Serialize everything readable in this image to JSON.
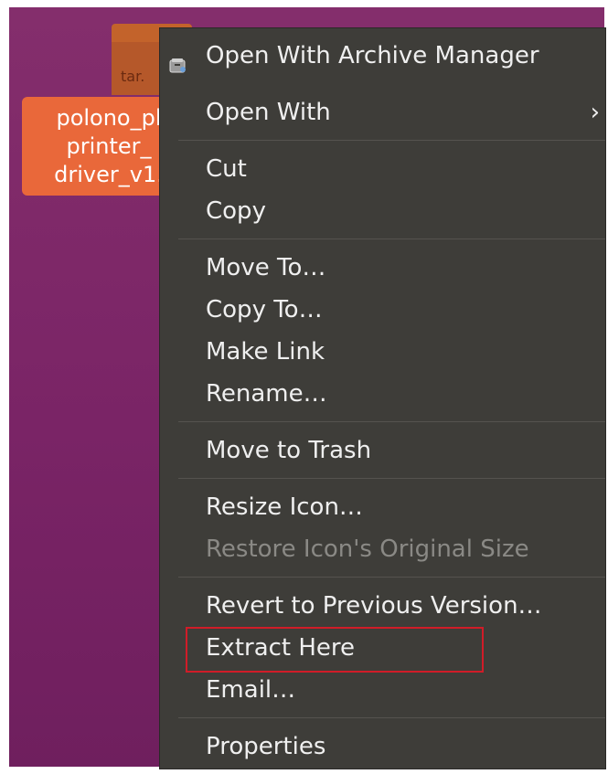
{
  "desktop": {
    "file": {
      "icon_label": "tar.",
      "name_lines": [
        "polono_pl",
        "printer_",
        "driver_v1."
      ]
    }
  },
  "context_menu": {
    "items": [
      {
        "label": "Open With Archive Manager",
        "icon": "archive-manager-icon"
      },
      {
        "label": "Open With",
        "submenu_indicator": "›"
      },
      {
        "label": "Cut"
      },
      {
        "label": "Copy"
      },
      {
        "label": "Move To…"
      },
      {
        "label": "Copy To…"
      },
      {
        "label": "Make Link"
      },
      {
        "label": "Rename…"
      },
      {
        "label": "Move to Trash"
      },
      {
        "label": "Resize Icon…"
      },
      {
        "label": "Restore Icon's Original Size",
        "disabled": true
      },
      {
        "label": "Revert to Previous Version…"
      },
      {
        "label": "Extract Here",
        "highlighted": true
      },
      {
        "label": "Email…"
      },
      {
        "label": "Properties"
      }
    ]
  },
  "colors": {
    "desktop_background": "#7a2466",
    "menu_background": "#3e3d39",
    "file_label_background": "#e9683a",
    "highlight_border": "#d01c28",
    "disabled_text": "#8a8985"
  }
}
